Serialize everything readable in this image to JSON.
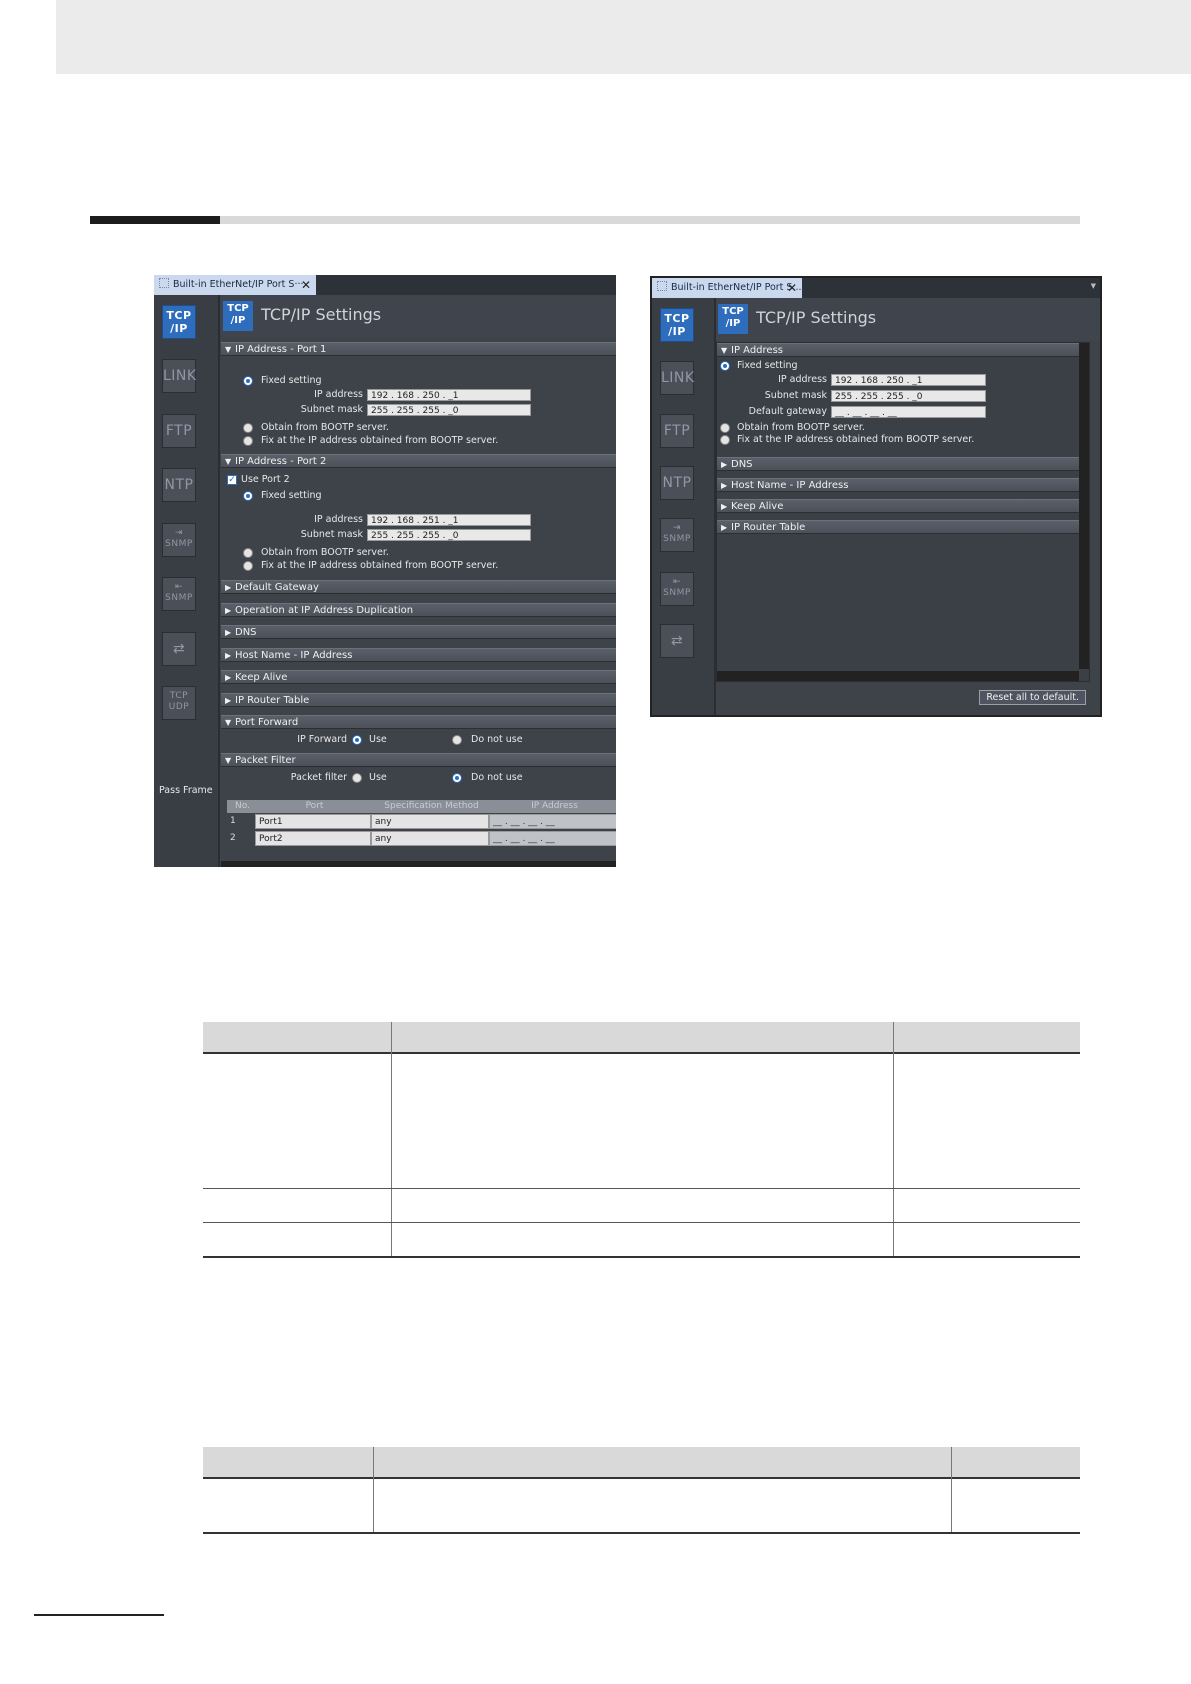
{
  "left_window": {
    "tab_title": "Built-in EtherNet/IP Port S···",
    "page_title": "TCP/IP Settings",
    "sidebar_icons": [
      {
        "name": "tcpip",
        "text": "TCP\n/IP"
      },
      {
        "name": "link",
        "text": "LINK"
      },
      {
        "name": "ftp",
        "text": "FTP"
      },
      {
        "name": "ntp",
        "text": "NTP"
      },
      {
        "name": "snmp-out",
        "text": "SNMP"
      },
      {
        "name": "snmp-in",
        "text": "SNMP"
      },
      {
        "name": "transfer",
        "text": ""
      },
      {
        "name": "tcp-udp",
        "text": "TCP UDP"
      }
    ],
    "port1": {
      "header": "IP Address - Port 1",
      "fixed_setting": "Fixed setting",
      "ip_label": "IP address",
      "ip_value": "192 . 168 . 250 . _1",
      "mask_label": "Subnet mask",
      "mask_value": "255 . 255 . 255 . _0",
      "bootp": "Obtain from BOOTP server.",
      "fix_bootp": "Fix at the IP address obtained from BOOTP server."
    },
    "port2": {
      "header": "IP Address - Port 2",
      "use_port2": "Use Port 2",
      "fixed_setting": "Fixed setting",
      "ip_label": "IP address",
      "ip_value": "192 . 168 . 251 . _1",
      "mask_label": "Subnet mask",
      "mask_value": "255 . 255 . 255 . _0",
      "bootp": "Obtain from BOOTP server.",
      "fix_bootp": "Fix at the IP address obtained from BOOTP server."
    },
    "collapsed_sections": [
      "Default Gateway",
      "Operation at IP Address Duplication",
      "DNS",
      "Host Name - IP Address",
      "Keep Alive",
      "IP Router Table"
    ],
    "port_forward": {
      "header": "Port Forward",
      "label": "IP Forward",
      "use": "Use",
      "do_not_use": "Do not use"
    },
    "packet_filter": {
      "header": "Packet Filter",
      "label": "Packet filter",
      "use": "Use",
      "do_not_use": "Do not use",
      "pass_frame": "Pass Frame",
      "columns": [
        "No.",
        "Port",
        "Specification Method",
        "IP Address"
      ],
      "rows": [
        [
          "1",
          "Port1",
          "any",
          "__ . __ . __ . __"
        ],
        [
          "2",
          "Port2",
          "any",
          "__ . __ . __ . __"
        ]
      ]
    }
  },
  "right_window": {
    "tab_title": "Built-in EtherNet/IP Port S...",
    "page_title": "TCP/IP Settings",
    "sidebar_icons": [
      {
        "name": "tcpip",
        "text": "TCP\n/IP"
      },
      {
        "name": "link",
        "text": "LINK"
      },
      {
        "name": "ftp",
        "text": "FTP"
      },
      {
        "name": "ntp",
        "text": "NTP"
      },
      {
        "name": "snmp-out",
        "text": "SNMP"
      },
      {
        "name": "snmp-in",
        "text": "SNMP"
      },
      {
        "name": "transfer",
        "text": ""
      }
    ],
    "ip": {
      "header": "IP Address",
      "fixed_setting": "Fixed setting",
      "ip_label": "IP address",
      "ip_value": "192 . 168 . 250 . _1",
      "mask_label": "Subnet mask",
      "mask_value": "255 . 255 . 255 . _0",
      "gw_label": "Default gateway",
      "gw_value": "__ . __ . __ . __",
      "bootp": "Obtain from BOOTP server.",
      "fix_bootp": "Fix at the IP address obtained from BOOTP server."
    },
    "collapsed_sections": [
      "DNS",
      "Host Name - IP Address",
      "Keep Alive",
      "IP Router Table"
    ],
    "reset_button": "Reset all to default."
  },
  "colors": {
    "accent": "#2e6dbc",
    "panel": "#3e4249",
    "section": "#555b64",
    "header_band": "#ebebeb",
    "table_head": "#d9d9d9"
  }
}
